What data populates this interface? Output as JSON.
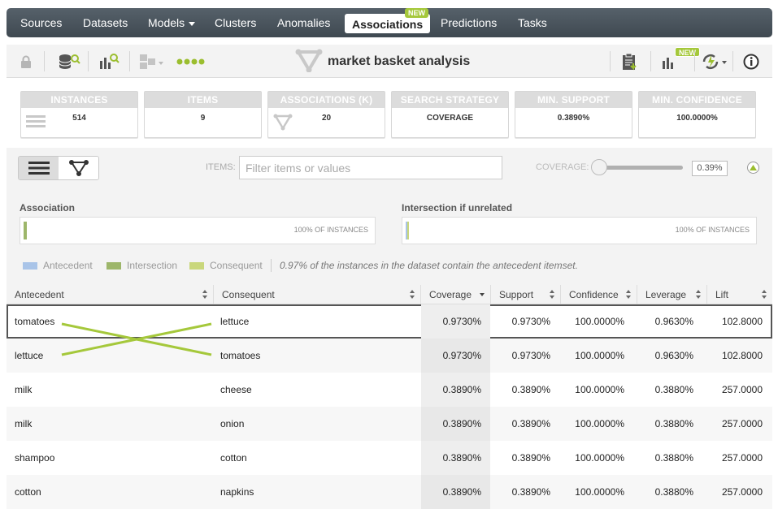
{
  "nav": {
    "items": [
      {
        "label": "Sources"
      },
      {
        "label": "Datasets"
      },
      {
        "label": "Models"
      },
      {
        "label": "Clusters"
      },
      {
        "label": "Anomalies"
      },
      {
        "label": "Associations",
        "active": true,
        "badge": "NEW"
      },
      {
        "label": "Predictions"
      },
      {
        "label": "Tasks"
      }
    ]
  },
  "toolbar": {
    "title": "market basket analysis",
    "new_badge": "NEW"
  },
  "cards": [
    {
      "label": "INSTANCES",
      "value": "514"
    },
    {
      "label": "ITEMS",
      "value": "9"
    },
    {
      "label": "ASSOCIATIONS (K)",
      "value": "20"
    },
    {
      "label": "SEARCH STRATEGY",
      "value": "COVERAGE"
    },
    {
      "label": "MIN. SUPPORT",
      "value": "0.3890%"
    },
    {
      "label": "MIN. CONFIDENCE",
      "value": "100.0000%"
    }
  ],
  "filter": {
    "items_label": "ITEMS:",
    "placeholder": "Filter items or values",
    "coverage_label": "COVERAGE:",
    "coverage_value": "0.39%",
    "coverage_fraction": 0.0
  },
  "association": {
    "title": "Association",
    "bar_text": "100% OF INSTANCES"
  },
  "intersection": {
    "title": "Intersection if unrelated",
    "bar_text": "100% OF INSTANCES"
  },
  "legend": {
    "antecedent": "Antecedent",
    "intersection": "Intersection",
    "consequent": "Consequent",
    "note": "0.97% of the instances in the dataset contain the antecedent itemset.",
    "colors": {
      "antecedent": "#a9c4e8",
      "intersection": "#9db66a",
      "consequent": "#c9d77c"
    }
  },
  "table": {
    "headers": [
      "Antecedent",
      "Consequent",
      "Coverage",
      "Support",
      "Confidence",
      "Leverage",
      "Lift"
    ],
    "rows": [
      [
        "tomatoes",
        "lettuce",
        "0.9730%",
        "0.9730%",
        "100.0000%",
        "0.9630%",
        "102.8000"
      ],
      [
        "lettuce",
        "tomatoes",
        "0.9730%",
        "0.9730%",
        "100.0000%",
        "0.9630%",
        "102.8000"
      ],
      [
        "milk",
        "cheese",
        "0.3890%",
        "0.3890%",
        "100.0000%",
        "0.3880%",
        "257.0000"
      ],
      [
        "milk",
        "onion",
        "0.3890%",
        "0.3890%",
        "100.0000%",
        "0.3880%",
        "257.0000"
      ],
      [
        "shampoo",
        "cotton",
        "0.3890%",
        "0.3890%",
        "100.0000%",
        "0.3880%",
        "257.0000"
      ],
      [
        "cotton",
        "napkins",
        "0.3890%",
        "0.3890%",
        "100.0000%",
        "0.3880%",
        "257.0000"
      ]
    ]
  }
}
